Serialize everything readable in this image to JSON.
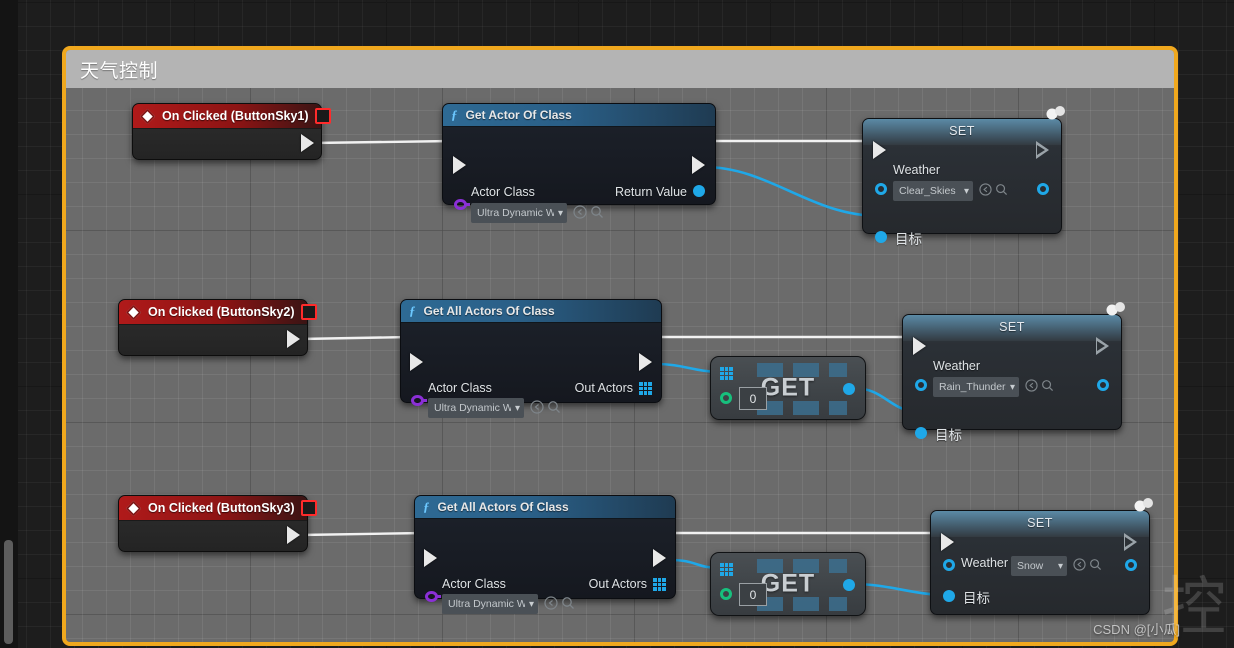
{
  "comment": {
    "title": "天气控制",
    "border_color": "#f0a81e",
    "header_color": "#b4b4b4",
    "body_color": "#6b6b6b"
  },
  "colors": {
    "exec_wire": "#f2f2f2",
    "data_wire": "#1fa8e8",
    "object_pin": "#1fa8e8",
    "class_pin": "#8b2fd6",
    "array_pin": "#1fa8e8",
    "index_pin": "#17c07d",
    "event_header": "#b01a1a",
    "function_header": "#2e6a94"
  },
  "rows": [
    {
      "event": {
        "title": "On Clicked (ButtonSky1)",
        "icon": "event-diamond-icon",
        "stop_icon": "stop-square-icon"
      },
      "function": {
        "title": "Get Actor Of Class",
        "glyph": "f",
        "input_label": "Actor Class",
        "input_value": "Ultra Dynamic W",
        "output_label": "Return Value"
      },
      "set": {
        "title": "SET",
        "property_label": "Weather",
        "property_value": "Clear_Skies",
        "target_label": "目标"
      }
    },
    {
      "event": {
        "title": "On Clicked (ButtonSky2)",
        "icon": "event-diamond-icon",
        "stop_icon": "stop-square-icon"
      },
      "function": {
        "title": "Get All Actors Of Class",
        "glyph": "f",
        "input_label": "Actor Class",
        "input_value": "Ultra Dynamic W",
        "output_label": "Out Actors"
      },
      "get": {
        "label": "GET",
        "index_value": "0"
      },
      "set": {
        "title": "SET",
        "property_label": "Weather",
        "property_value": "Rain_Thundersto",
        "target_label": "目标"
      }
    },
    {
      "event": {
        "title": "On Clicked (ButtonSky3)",
        "icon": "event-diamond-icon",
        "stop_icon": "stop-square-icon"
      },
      "function": {
        "title": "Get All Actors Of Class",
        "glyph": "f",
        "input_label": "Actor Class",
        "input_value": "Ultra Dynamic W",
        "output_label": "Out Actors"
      },
      "get": {
        "label": "GET",
        "index_value": "0"
      },
      "set": {
        "title": "SET",
        "property_label": "Weather",
        "property_value": "Snow",
        "target_label": "目标"
      }
    }
  ],
  "watermark": {
    "small": "CSDN @[小瓜]",
    "big": "控"
  }
}
